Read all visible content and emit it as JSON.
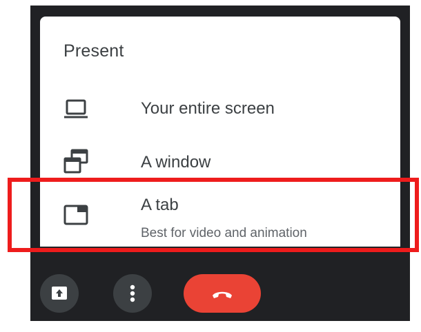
{
  "menu": {
    "title": "Present",
    "items": [
      {
        "label": "Your entire screen",
        "icon": "monitor-icon"
      },
      {
        "label": "A window",
        "icon": "window-icon"
      },
      {
        "label": "A tab",
        "sublabel": "Best for video and animation",
        "icon": "tab-icon",
        "highlighted": true
      }
    ]
  },
  "controls": {
    "buttons": [
      {
        "icon": "present-screen-icon"
      },
      {
        "icon": "more-options-icon"
      },
      {
        "icon": "end-call-icon"
      }
    ]
  },
  "colors": {
    "highlight": "#ee1c1c",
    "end_call": "#ea4335",
    "panel_background": "#202124",
    "control_button": "#3c4043",
    "text_primary": "#3c4043",
    "text_secondary": "#5f6368"
  }
}
